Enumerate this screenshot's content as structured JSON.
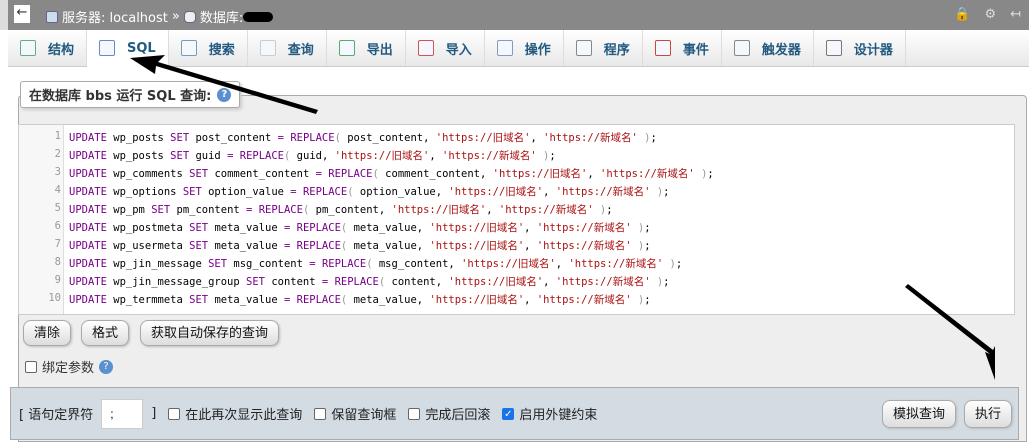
{
  "topbar": {
    "back": "←",
    "server_label": "服务器: localhost",
    "sep": "»",
    "db_label": "数据库:"
  },
  "tabs": [
    {
      "label": "结构",
      "icon": "structure-icon"
    },
    {
      "label": "SQL",
      "icon": "sql-scroll-icon",
      "active": true
    },
    {
      "label": "搜索",
      "icon": "search-icon"
    },
    {
      "label": "查询",
      "icon": "database-icon"
    },
    {
      "label": "导出",
      "icon": "export-icon"
    },
    {
      "label": "导入",
      "icon": "import-icon"
    },
    {
      "label": "操作",
      "icon": "wrench-icon"
    },
    {
      "label": "程序",
      "icon": "routines-icon"
    },
    {
      "label": "事件",
      "icon": "clock-icon"
    },
    {
      "label": "触发器",
      "icon": "trigger-icon"
    },
    {
      "label": "设计器",
      "icon": "designer-icon"
    }
  ],
  "legend": "在数据库 bbs 运行 SQL 查询:",
  "editor": {
    "lines": [
      [
        "wp_posts",
        "post_content"
      ],
      [
        "wp_posts",
        "guid"
      ],
      [
        "wp_comments",
        "comment_content"
      ],
      [
        "wp_options",
        "option_value"
      ],
      [
        "wp_pm",
        "pm_content"
      ],
      [
        "wp_postmeta",
        "meta_value"
      ],
      [
        "wp_usermeta",
        "meta_value"
      ],
      [
        "wp_jin_message",
        "msg_content"
      ],
      [
        "wp_jin_message_group",
        "content"
      ],
      [
        "wp_termmeta",
        "meta_value"
      ]
    ],
    "old": "'https://旧域名'",
    "new": "'https://新域名'"
  },
  "buttons": {
    "clear": "清除",
    "format": "格式",
    "autosave": "获取自动保存的查询",
    "simulate": "模拟查询",
    "go": "执行"
  },
  "bind_params": "绑定参数",
  "footer": {
    "delimiter_label_open": "[ 语句定界符",
    "delimiter_value": ";",
    "delimiter_label_close": "]",
    "show_again": "在此再次显示此查询",
    "retain_box": "保留查询框",
    "rollback": "完成后回滚",
    "fk_checks": "启用外键约束",
    "fk_checked": true
  }
}
